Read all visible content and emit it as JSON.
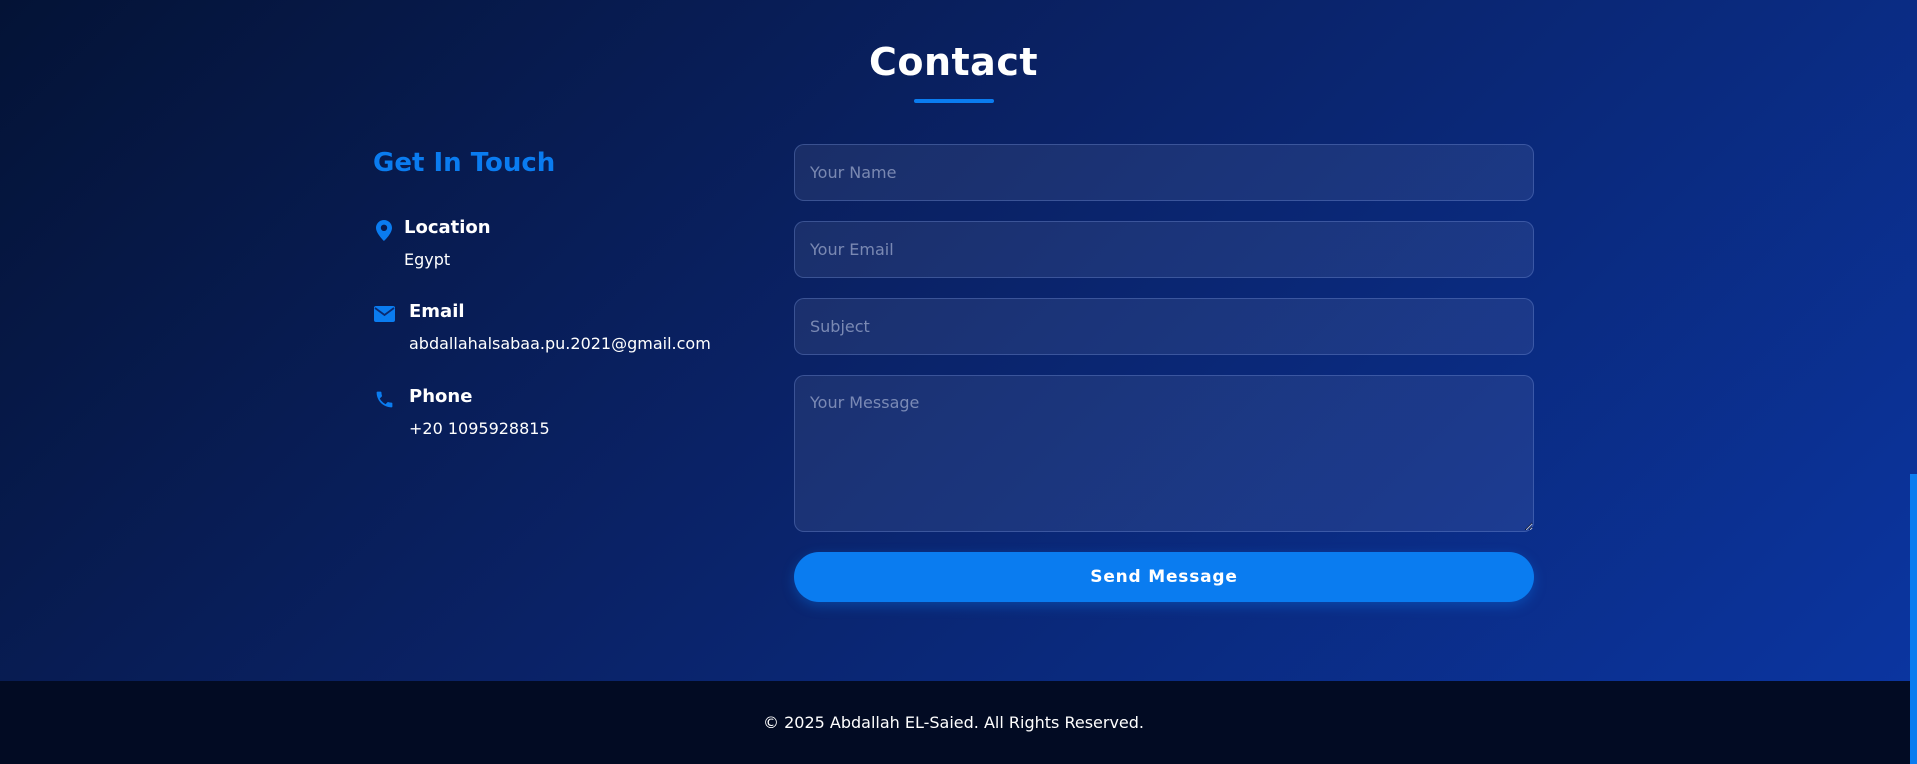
{
  "contact": {
    "title": "Contact",
    "get_in_touch": "Get In Touch",
    "location": {
      "label": "Location",
      "value": "Egypt",
      "icon": "map-marker-icon"
    },
    "email": {
      "label": "Email",
      "value": "abdallahalsabaa.pu.2021@gmail.com",
      "icon": "envelope-icon"
    },
    "phone": {
      "label": "Phone",
      "value": "+20 1095928815",
      "icon": "phone-icon"
    }
  },
  "form": {
    "name_placeholder": "Your Name",
    "email_placeholder": "Your Email",
    "subject_placeholder": "Subject",
    "message_placeholder": "Your Message",
    "submit_label": "Send Message"
  },
  "footer": {
    "copyright": "© 2025 Abdallah EL-Saied. All Rights Reserved."
  },
  "colors": {
    "accent": "#0a7cf0",
    "footer_bg": "#020b23",
    "bg_dark": "#041336",
    "bg_light": "#0b35a0"
  }
}
